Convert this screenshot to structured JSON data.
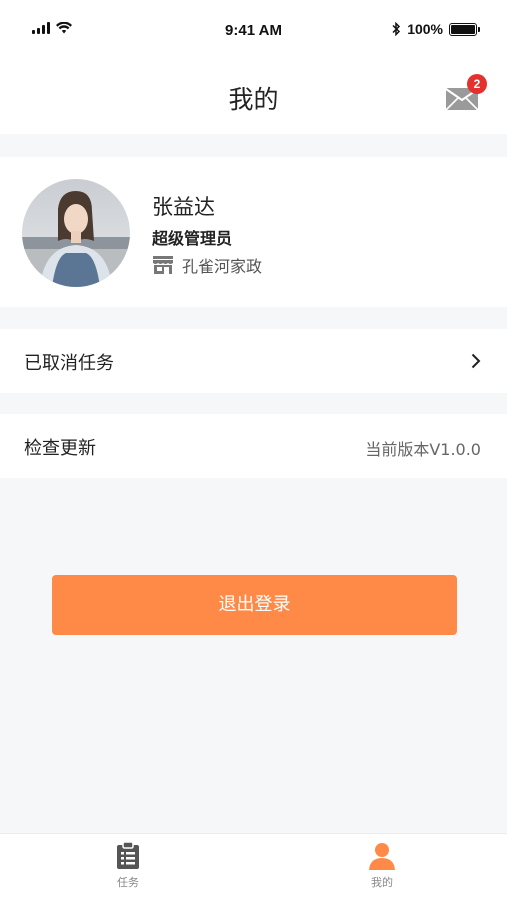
{
  "status_bar": {
    "time": "9:41 AM",
    "battery": "100%"
  },
  "nav": {
    "title": "我的",
    "unread_count": "2"
  },
  "profile": {
    "name": "张益达",
    "role": "超级管理员",
    "organization": "孔雀河家政"
  },
  "menu": {
    "cancelled_tasks_label": "已取消任务",
    "check_update_label": "检查更新",
    "version_text": "当前版本V1.0.0"
  },
  "logout_label": "退出登录",
  "tabs": [
    {
      "label": "任务",
      "icon": "clipboard-icon"
    },
    {
      "label": "我的",
      "icon": "person-icon"
    }
  ],
  "colors": {
    "accent": "#ff8a47",
    "badge": "#e3312d",
    "background": "#f6f7f9"
  }
}
